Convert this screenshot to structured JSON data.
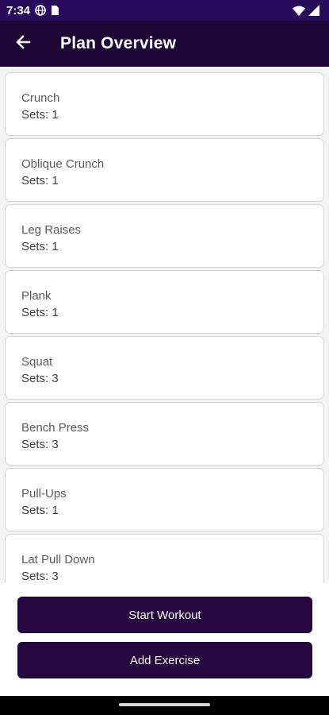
{
  "status_bar": {
    "time": "7:34",
    "icons": [
      "globe-icon",
      "sim-card-icon",
      "wifi-icon",
      "signal-icon"
    ]
  },
  "app_bar": {
    "title": "Plan Overview",
    "back_icon": "arrow-back-icon"
  },
  "exercises": [
    {
      "name": "Crunch",
      "sets": "Sets:  1"
    },
    {
      "name": "Oblique Crunch",
      "sets": "Sets:  1"
    },
    {
      "name": "Leg Raises",
      "sets": "Sets:  1"
    },
    {
      "name": "Plank",
      "sets": "Sets:  1"
    },
    {
      "name": "Squat",
      "sets": "Sets:  3"
    },
    {
      "name": "Bench Press",
      "sets": "Sets:  3"
    },
    {
      "name": "Pull-Ups",
      "sets": "Sets:  1"
    },
    {
      "name": "Lat Pull Down",
      "sets": "Sets:  3"
    }
  ],
  "buttons": {
    "start_workout": "Start Workout",
    "add_exercise": "Add Exercise"
  },
  "colors": {
    "status_bar": "#2a0a5a",
    "app_bar": "#1e0637",
    "button": "#26073f"
  }
}
